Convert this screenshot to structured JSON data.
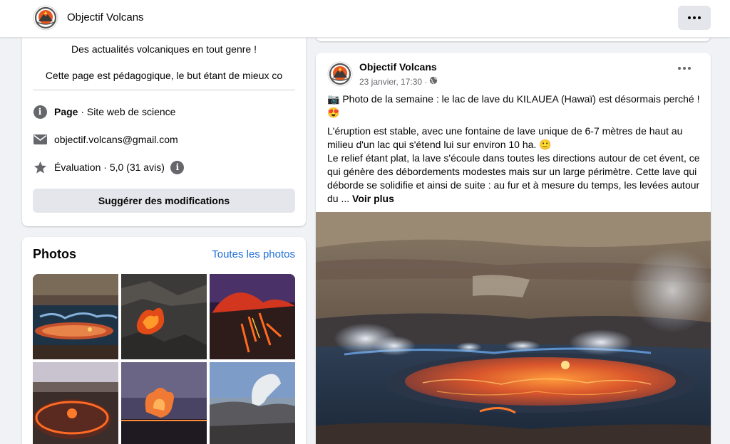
{
  "header": {
    "page_name": "Objectif Volcans",
    "logo_icon": "objectif-volcans-logo"
  },
  "intro": {
    "description_line1": "Des actualités volcaniques en tout genre !",
    "description_line2": "Cette page est pédagogique, le but étant de mieux co",
    "category_bold": "Page",
    "category_rest": " · Site web de science",
    "email": "objectif.volcans@gmail.com",
    "rating": "Évaluation · 5,0 (31 avis)",
    "suggest_button": "Suggérer des modifications"
  },
  "photos": {
    "title": "Photos",
    "see_all": "Toutes les photos",
    "items": [
      "lava-lake-photo",
      "lava-fountain-photo",
      "night-eruption-photo",
      "crater-lake-photo",
      "eruption-plume-photo",
      "volcano-smoke-photo"
    ]
  },
  "post": {
    "author": "Objectif Volcans",
    "date": "23 janvier, 17:30 ·",
    "paragraph1": "📷 Photo de la semaine : le lac de lave du KILAUEA (Hawaï) est désormais perché ! 😍",
    "paragraph2": "L'éruption est stable, avec une fontaine de lave unique de 6-7 mètres de haut au milieu d'un lac qui s'étend lui sur environ 10 ha. 🙂",
    "paragraph3": "Le relief étant plat, la lave s'écoule dans toutes les directions autour de cet évent, ce qui génère des débordements modestes mais sur un large périmètre. Cette lave qui déborde se solidifie et ainsi de suite : au fur et à mesure du temps, les levées autour du ...",
    "see_more": "Voir plus",
    "image": "kilauea-lava-lake-photo"
  },
  "colors": {
    "link": "#216fdb",
    "background": "#f0f2f5",
    "button": "#e4e6eb"
  }
}
